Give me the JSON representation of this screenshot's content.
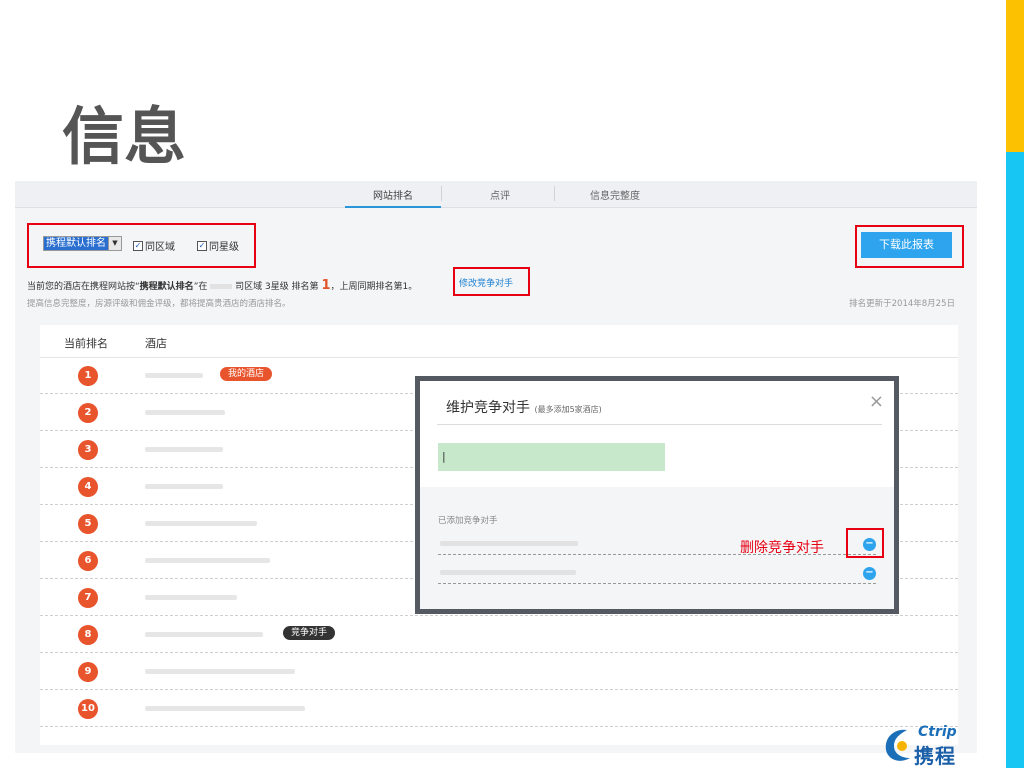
{
  "slide": {
    "title": "信息"
  },
  "tabs": [
    "网站排名",
    "点评",
    "信息完整度"
  ],
  "toolbar": {
    "sort_select": "携程默认排名",
    "checkbox_same_area": "同区域",
    "checkbox_same_star": "同星级",
    "download_label": "下载此报表"
  },
  "info": {
    "line1_prefix": "当前您的酒店在携程网站按“",
    "line1_sort": "携程默认排名",
    "line1_mid": "”在",
    "line1_area": "司区域 3星级 排名第",
    "line1_rank": "1",
    "line1_suffix": "，上周同期排名第1。",
    "modify_competitor": "修改竞争对手",
    "line2": "提高信息完整度，房源评级和佣金评级，都将提高贵酒店的酒店排名。",
    "updated": "排名更新于2014年8月25日"
  },
  "table": {
    "col_rank": "当前排名",
    "col_hotel": "酒店",
    "rows": [
      {
        "rank": "1",
        "badge": "我的酒店"
      },
      {
        "rank": "2",
        "badge": ""
      },
      {
        "rank": "3",
        "badge": ""
      },
      {
        "rank": "4",
        "badge": ""
      },
      {
        "rank": "5",
        "badge": ""
      },
      {
        "rank": "6",
        "badge": ""
      },
      {
        "rank": "7",
        "badge": ""
      },
      {
        "rank": "8",
        "badge": "竞争对手"
      },
      {
        "rank": "9",
        "badge": ""
      },
      {
        "rank": "10",
        "badge": ""
      }
    ]
  },
  "modal": {
    "title": "维护竞争对手",
    "subtitle": "(最多添加5家酒店)",
    "close": "×",
    "input_value": "|",
    "added_label": "已添加竞争对手",
    "remove_icon": "−"
  },
  "annotation": {
    "delete_label": "删除竞争对手"
  },
  "logo": {
    "top": "Ctrip",
    "bottom": "携程"
  },
  "colors": {
    "accent": "#2ea3ee",
    "rank_circle": "#e8542c",
    "highlight_box": "#e60012"
  }
}
